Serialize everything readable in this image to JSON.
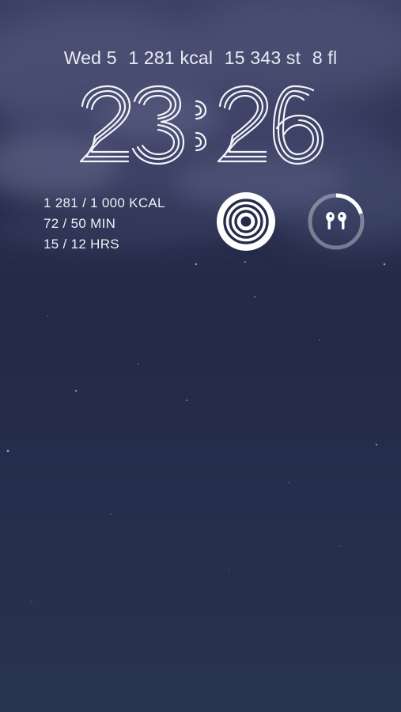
{
  "status": {
    "date": "Wed 5",
    "calories": "1 281 kcal",
    "steps": "15 343 st",
    "floors": "8 fl"
  },
  "clock": {
    "hours": "23",
    "minutes": "26"
  },
  "activity": {
    "move": "1 281 / 1 000 KCAL",
    "exercise": "72 / 50 MIN",
    "stand": "15 / 12 HRS"
  },
  "widgets": {
    "activity_rings_icon": "activity-rings-icon",
    "airpods_icon": "airpods-icon",
    "airpods_battery_level": 0.2
  },
  "colors": {
    "text": "#eef0f6",
    "widget_fill": "#ffffff",
    "background_top": "#3a3f62",
    "background_bottom": "#29344f"
  }
}
